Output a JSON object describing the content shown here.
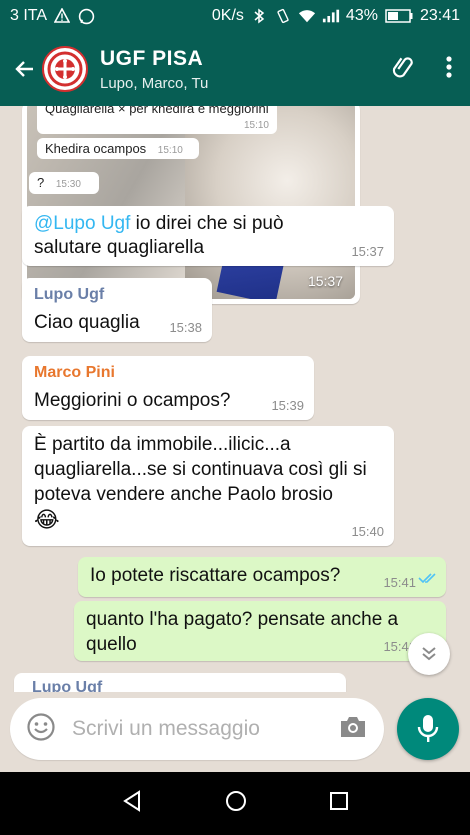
{
  "statusbar": {
    "carrier": "3 ITA",
    "network_speed": "0K/s",
    "battery": "43%",
    "time": "23:41"
  },
  "header": {
    "group_name": "UGF PISA",
    "participants": "Lupo, Marco, Tu"
  },
  "media_message": {
    "previews": [
      {
        "text": "Quagliarella × per khedira e meggiorini",
        "time": "15:10"
      },
      {
        "text": "Khedira ocampos",
        "time": "15:10"
      },
      {
        "text": "?",
        "time": "15:30"
      }
    ],
    "time": "15:37"
  },
  "messages": [
    {
      "mention": "@Lupo Ugf",
      "text": " io direi che si può salutare quagliarella",
      "time": "15:37"
    },
    {
      "sender": "Lupo Ugf",
      "text": "Ciao quaglia",
      "time": "15:38"
    },
    {
      "sender": "Marco Pini",
      "text": "Meggiorini o ocampos?",
      "time": "15:39"
    },
    {
      "text": "È partito da immobile...ilicic...a quagliarella...se si continuava così gli si poteva vendere anche Paolo brosio",
      "emoji": "😂",
      "time": "15:40"
    },
    {
      "text": "Io potete riscattare ocampos?",
      "time": "15:41"
    },
    {
      "text": "quanto l'ha pagato? pensate anche a quello",
      "time": "15:41"
    },
    {
      "sender": "Lupo Ugf"
    }
  ],
  "composer": {
    "placeholder": "Scrivi un messaggio"
  },
  "colors": {
    "header": "#075e54",
    "outgoing_bubble": "#dcf8c6",
    "incoming_bubble": "#ffffff",
    "lupo_name": "#6a7fa8",
    "marco_name": "#e8772e",
    "mic_button": "#00897b",
    "read_ticks": "#4fc3f7"
  }
}
